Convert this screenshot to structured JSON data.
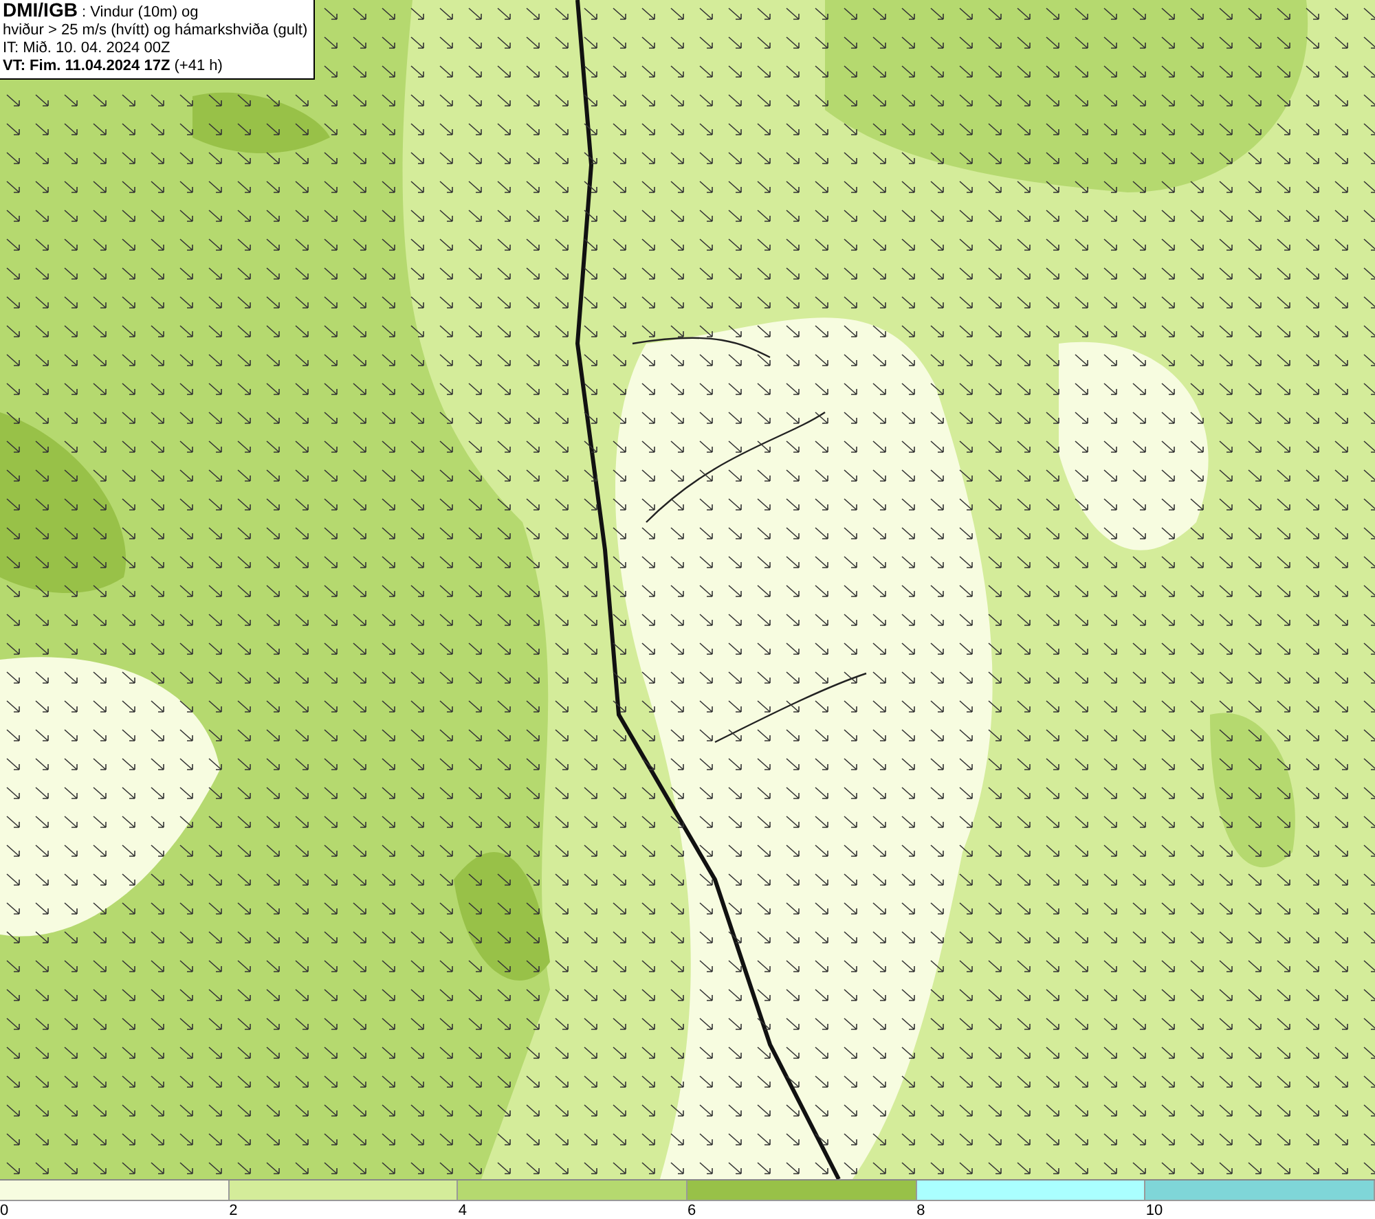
{
  "info_box": {
    "lines": [
      "**DMI/IGB** : Vindur (10m) og",
      "hviður > 25 m/s (hvítt) og hámarkshviða (gult)",
      "IT: Mið. 10. 04. 2024 00Z",
      "**VT: Fim. 11.04.2024 17Z** (+41 h)"
    ]
  },
  "color_scale": {
    "segments": [
      {
        "color": "#f7fce0",
        "label": "0"
      },
      {
        "color": "#d4ec9a",
        "label": "2"
      },
      {
        "color": "#b5d96f",
        "label": "4"
      },
      {
        "color": "#98c148",
        "label": "6"
      },
      {
        "color": "#aaffff",
        "label": "8"
      },
      {
        "color": "#7fd6d8",
        "label": "10"
      }
    ]
  }
}
